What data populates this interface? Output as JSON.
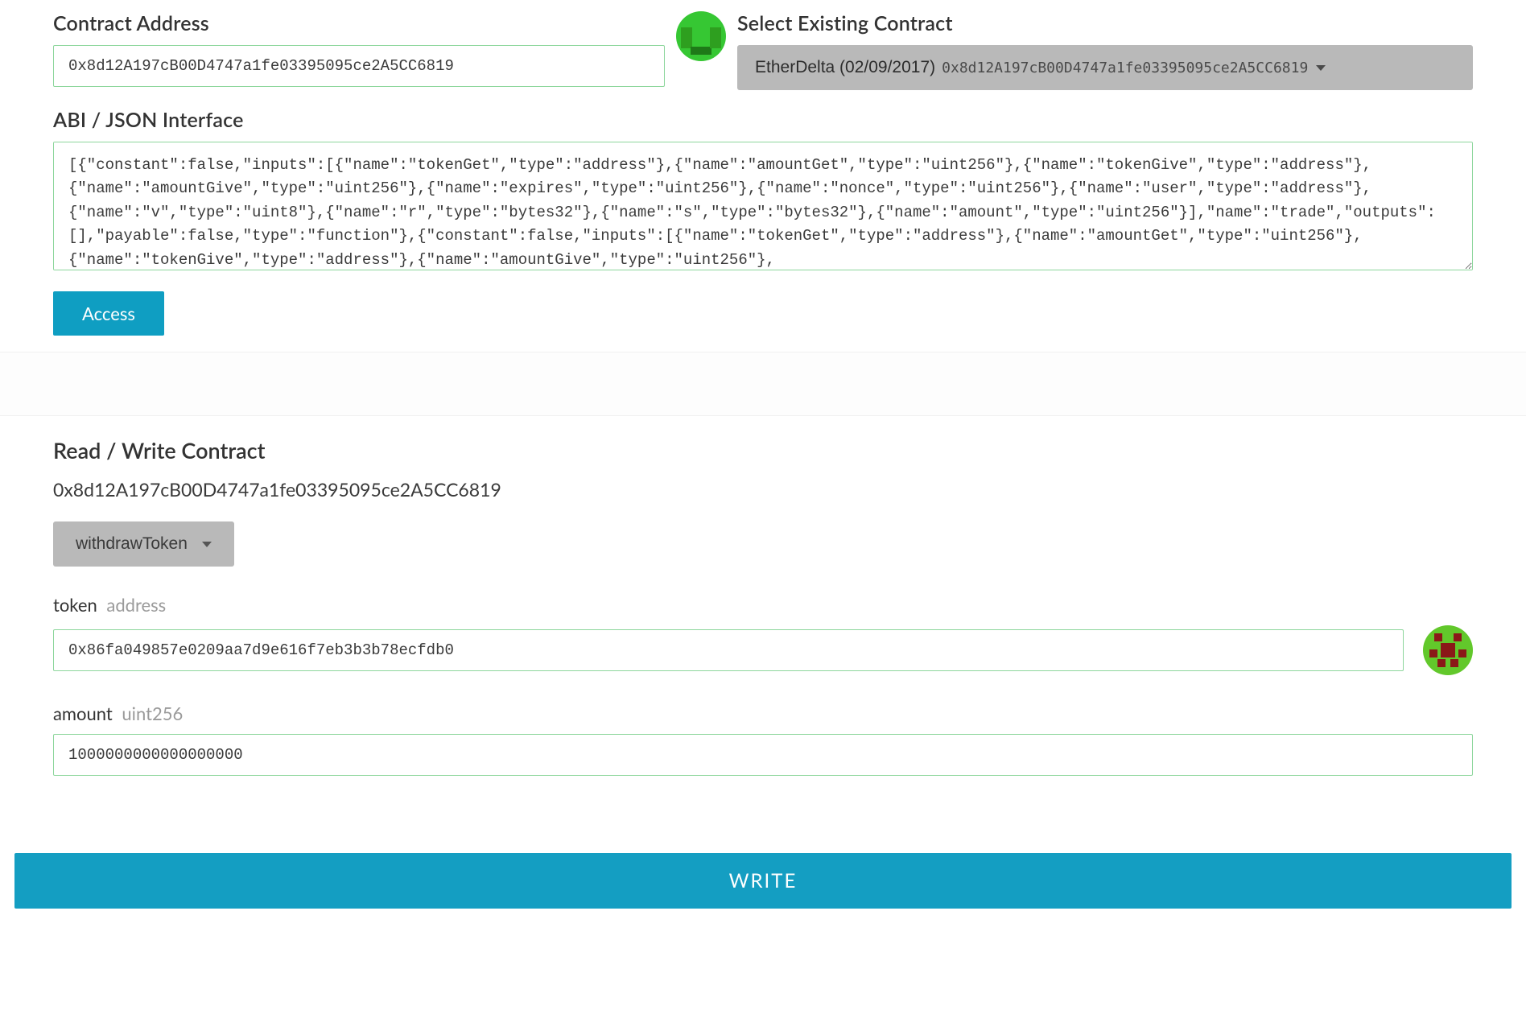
{
  "top": {
    "contract_address_label": "Contract Address",
    "contract_address_value": "0x8d12A197cB00D4747a1fe03395095ce2A5CC6819",
    "select_existing_label": "Select Existing Contract",
    "select_existing_selected_name": "EtherDelta (02/09/2017)",
    "select_existing_selected_addr": "0x8d12A197cB00D4747a1fe03395095ce2A5CC6819",
    "abi_label": "ABI / JSON Interface",
    "abi_value": "[{\"constant\":false,\"inputs\":[{\"name\":\"tokenGet\",\"type\":\"address\"},{\"name\":\"amountGet\",\"type\":\"uint256\"},{\"name\":\"tokenGive\",\"type\":\"address\"},{\"name\":\"amountGive\",\"type\":\"uint256\"},{\"name\":\"expires\",\"type\":\"uint256\"},{\"name\":\"nonce\",\"type\":\"uint256\"},{\"name\":\"user\",\"type\":\"address\"},{\"name\":\"v\",\"type\":\"uint8\"},{\"name\":\"r\",\"type\":\"bytes32\"},{\"name\":\"s\",\"type\":\"bytes32\"},{\"name\":\"amount\",\"type\":\"uint256\"}],\"name\":\"trade\",\"outputs\":[],\"payable\":false,\"type\":\"function\"},{\"constant\":false,\"inputs\":[{\"name\":\"tokenGet\",\"type\":\"address\"},{\"name\":\"amountGet\",\"type\":\"uint256\"},{\"name\":\"tokenGive\",\"type\":\"address\"},{\"name\":\"amountGive\",\"type\":\"uint256\"},",
    "access_button": "Access"
  },
  "bottom": {
    "rw_title": "Read / Write Contract",
    "rw_address": "0x8d12A197cB00D4747a1fe03395095ce2A5CC6819",
    "function_selected": "withdrawToken",
    "params": {
      "token": {
        "label": "token",
        "type": "address",
        "value": "0x86fa049857e0209aa7d9e616f7eb3b3b78ecfdb0"
      },
      "amount": {
        "label": "amount",
        "type": "uint256",
        "value": "1000000000000000000"
      }
    },
    "write_button": "WRITE"
  },
  "icons": {
    "contract_identicon": "identicon-green",
    "token_identicon": "identicon-red",
    "dropdown_caret": "caret-down-icon"
  },
  "colors": {
    "primary": "#149ec2",
    "input_border_valid": "#8dd69c",
    "dropdown_bg": "#b9b9b9"
  }
}
